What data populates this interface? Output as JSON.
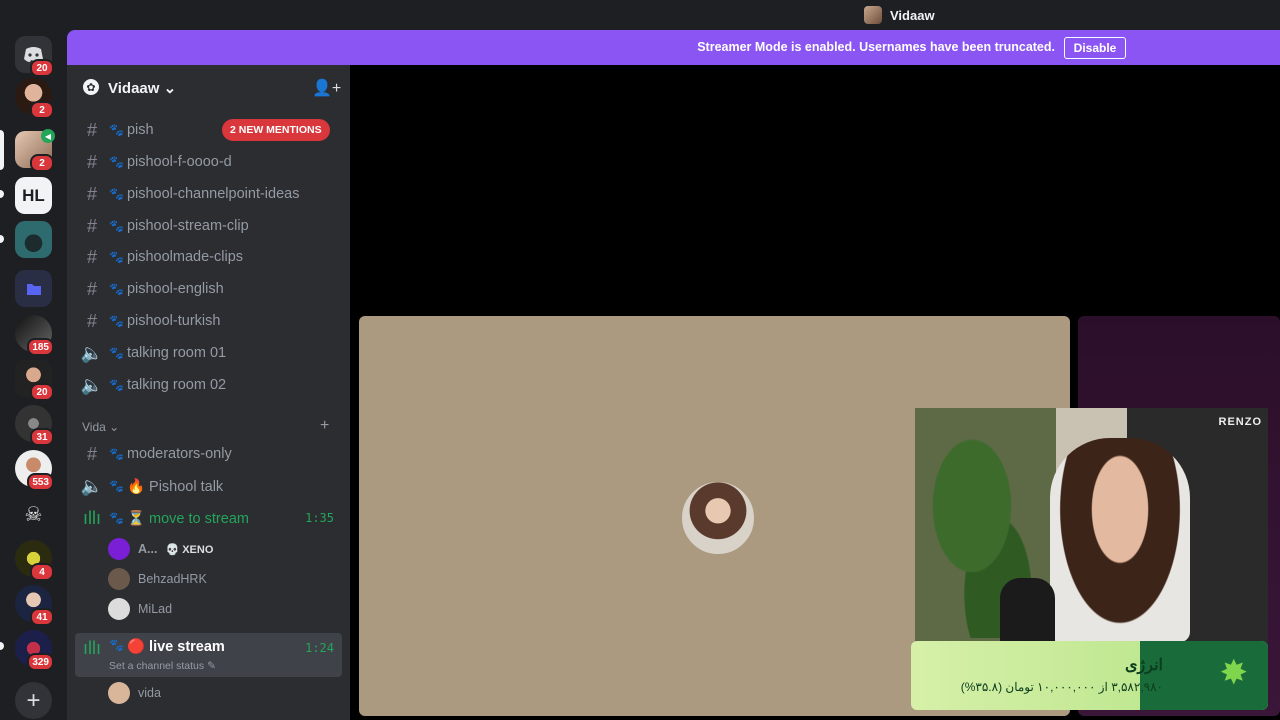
{
  "titlebar": {
    "user": "Vidaaw"
  },
  "banner": {
    "message": "Streamer Mode is enabled. Usernames have been truncated.",
    "button": "Disable"
  },
  "servers": {
    "badges": [
      "20",
      "2",
      "2",
      "185",
      "20",
      "31",
      "553",
      "4",
      "41",
      "329"
    ],
    "hl_label": "HL",
    "add_icon": "+"
  },
  "guild": {
    "name": "Vidaaw",
    "chevron": "⌄"
  },
  "channels": [
    {
      "name": "pish",
      "type": "text"
    },
    {
      "name": "pishool-f-oooo-d",
      "type": "text"
    },
    {
      "name": "pishool-channelpoint-ideas",
      "type": "text"
    },
    {
      "name": "pishool-stream-clip",
      "type": "text"
    },
    {
      "name": "pishoolmade-clips",
      "type": "text"
    },
    {
      "name": "pishool-english",
      "type": "text"
    },
    {
      "name": "pishool-turkish",
      "type": "text"
    },
    {
      "name": "talking room 01",
      "type": "voice"
    },
    {
      "name": "talking room 02",
      "type": "voice"
    }
  ],
  "mentions": "2 NEW MENTIONS",
  "category": {
    "name": "Vida",
    "add": "+"
  },
  "vida_channels": [
    {
      "name": "moderators-only",
      "type": "text"
    },
    {
      "name": "🔥 Pishool talk",
      "type": "voice"
    },
    {
      "name": "⏳ move to stream",
      "type": "live",
      "time": "1:35"
    },
    {
      "name": "🔴 live stream",
      "type": "live",
      "time": "1:24",
      "status": "Set a channel status"
    }
  ],
  "members_move": [
    {
      "name": "A...",
      "tag": "💀 XENO",
      "avatar_color": "#7a1fd6"
    },
    {
      "name": "BehzadHRK",
      "tag": "",
      "avatar_color": "#6b5a4c"
    },
    {
      "name": "MiLad",
      "tag": "",
      "avatar_color": "#dcdcdc"
    }
  ],
  "members_live": [
    {
      "name": "vida",
      "avatar_color": "#d9b59a"
    }
  ],
  "stream": {
    "chair_brand": "RENZO",
    "energy_title": "انرژی",
    "energy_detail": "۳,۵۸۲,۹۸۰ از ۱۰,۰۰۰,۰۰۰ تومان (۳۵.۸%)",
    "energy_progress": 0.358
  },
  "colors": {
    "accent": "#8a55f2",
    "green": "#23a55a",
    "danger": "#da373c"
  }
}
